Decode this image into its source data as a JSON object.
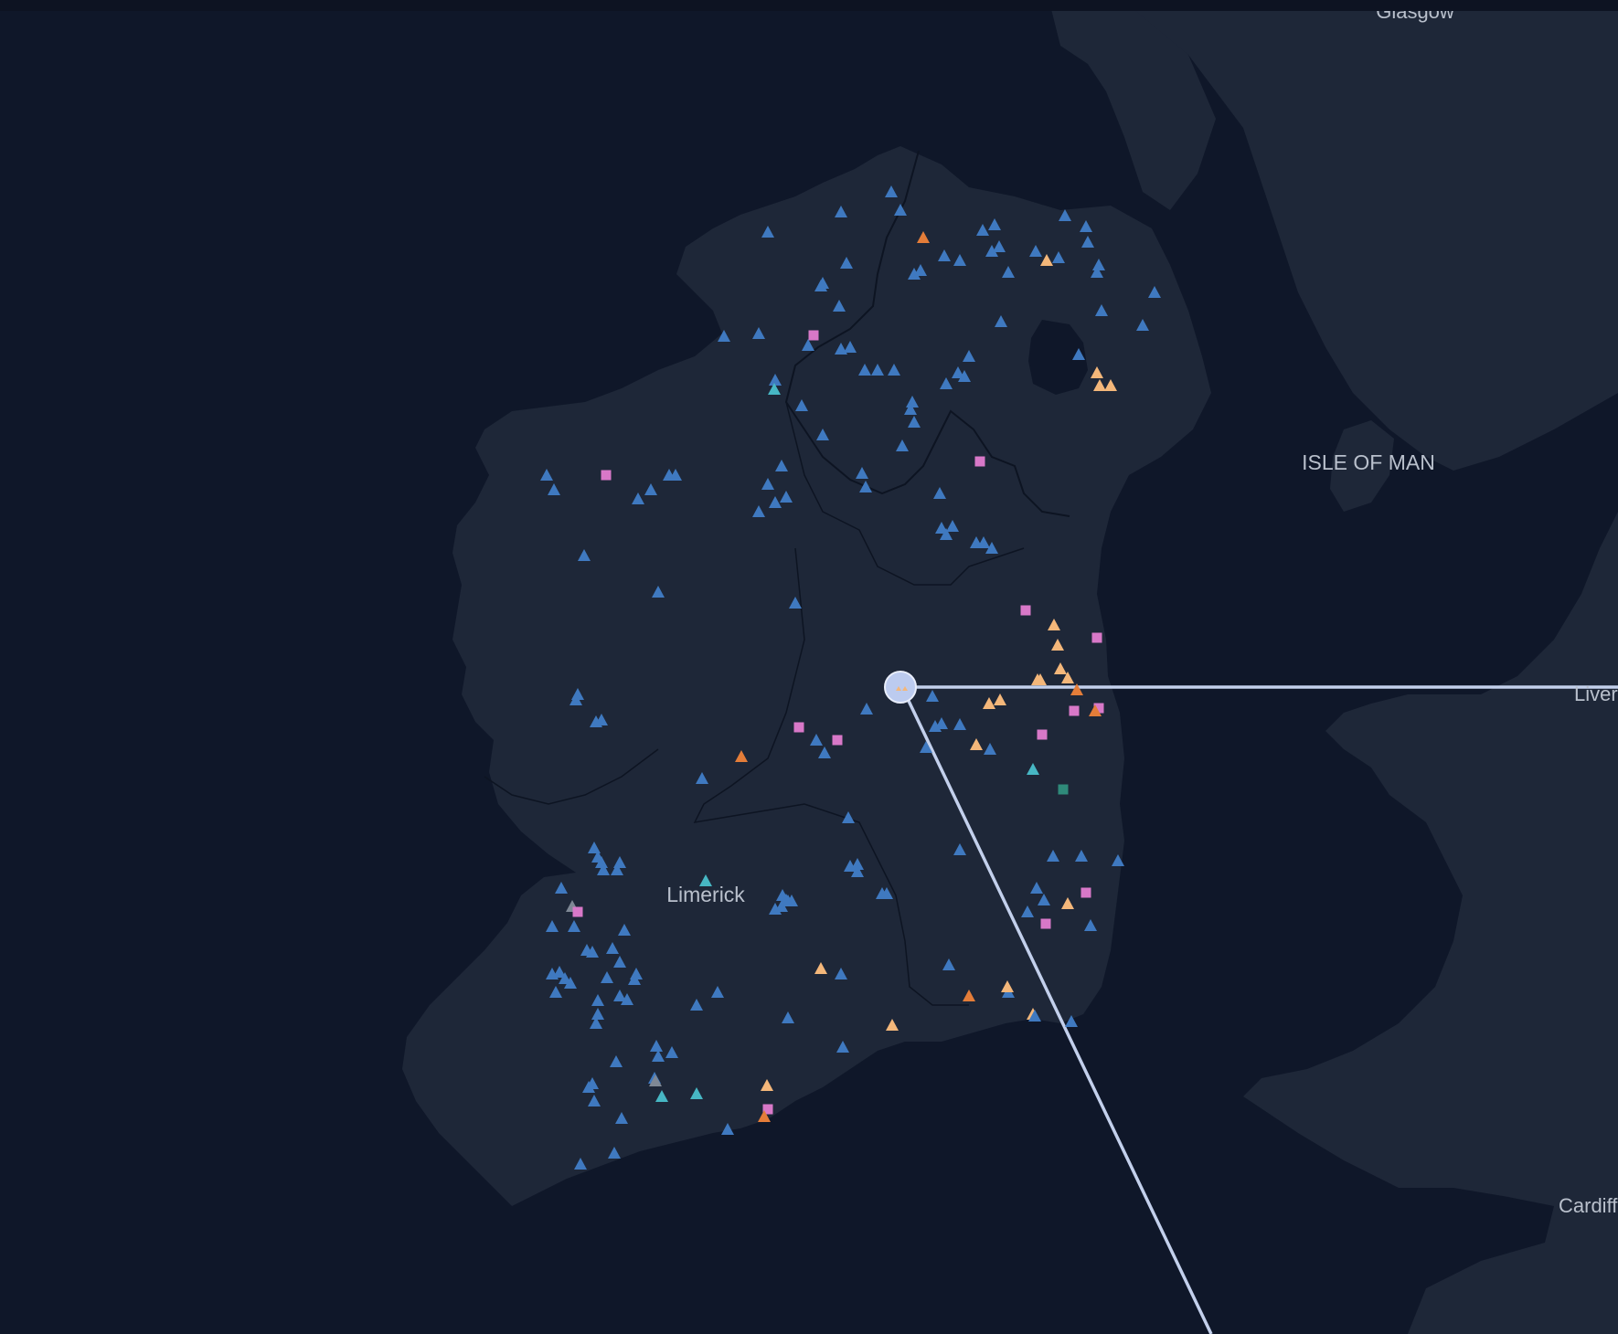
{
  "map": {
    "place_labels": {
      "glasgow": "Glasgow",
      "isle_of_man": "ISLE OF MAN",
      "liverpool": "Liver",
      "cardiff": "Cardiff",
      "limerick": "Limerick"
    },
    "colors": {
      "sea": "#0f1729",
      "land": "#1e2738",
      "border": "#0d1422",
      "line": "#c3d0ec",
      "node": "#bccbef",
      "blue": "#3f79c0",
      "orange": "#e47d39",
      "peach": "#f4b77a",
      "teal": "#47b7c4",
      "pink": "#d878c8",
      "green": "#2f8a7a",
      "grey": "#7f8895"
    },
    "marker_types": {
      "b": {
        "shape": "triangle",
        "color": "blue"
      },
      "o": {
        "shape": "triangle",
        "color": "orange"
      },
      "p": {
        "shape": "triangle",
        "color": "peach"
      },
      "t": {
        "shape": "triangle",
        "color": "teal"
      },
      "g": {
        "shape": "triangle",
        "color": "grey"
      },
      "s": {
        "shape": "square",
        "color": "pink"
      },
      "q": {
        "shape": "square",
        "color": "green"
      }
    },
    "hub": {
      "icon": "cluster-node-icon",
      "connections": 2
    }
  }
}
